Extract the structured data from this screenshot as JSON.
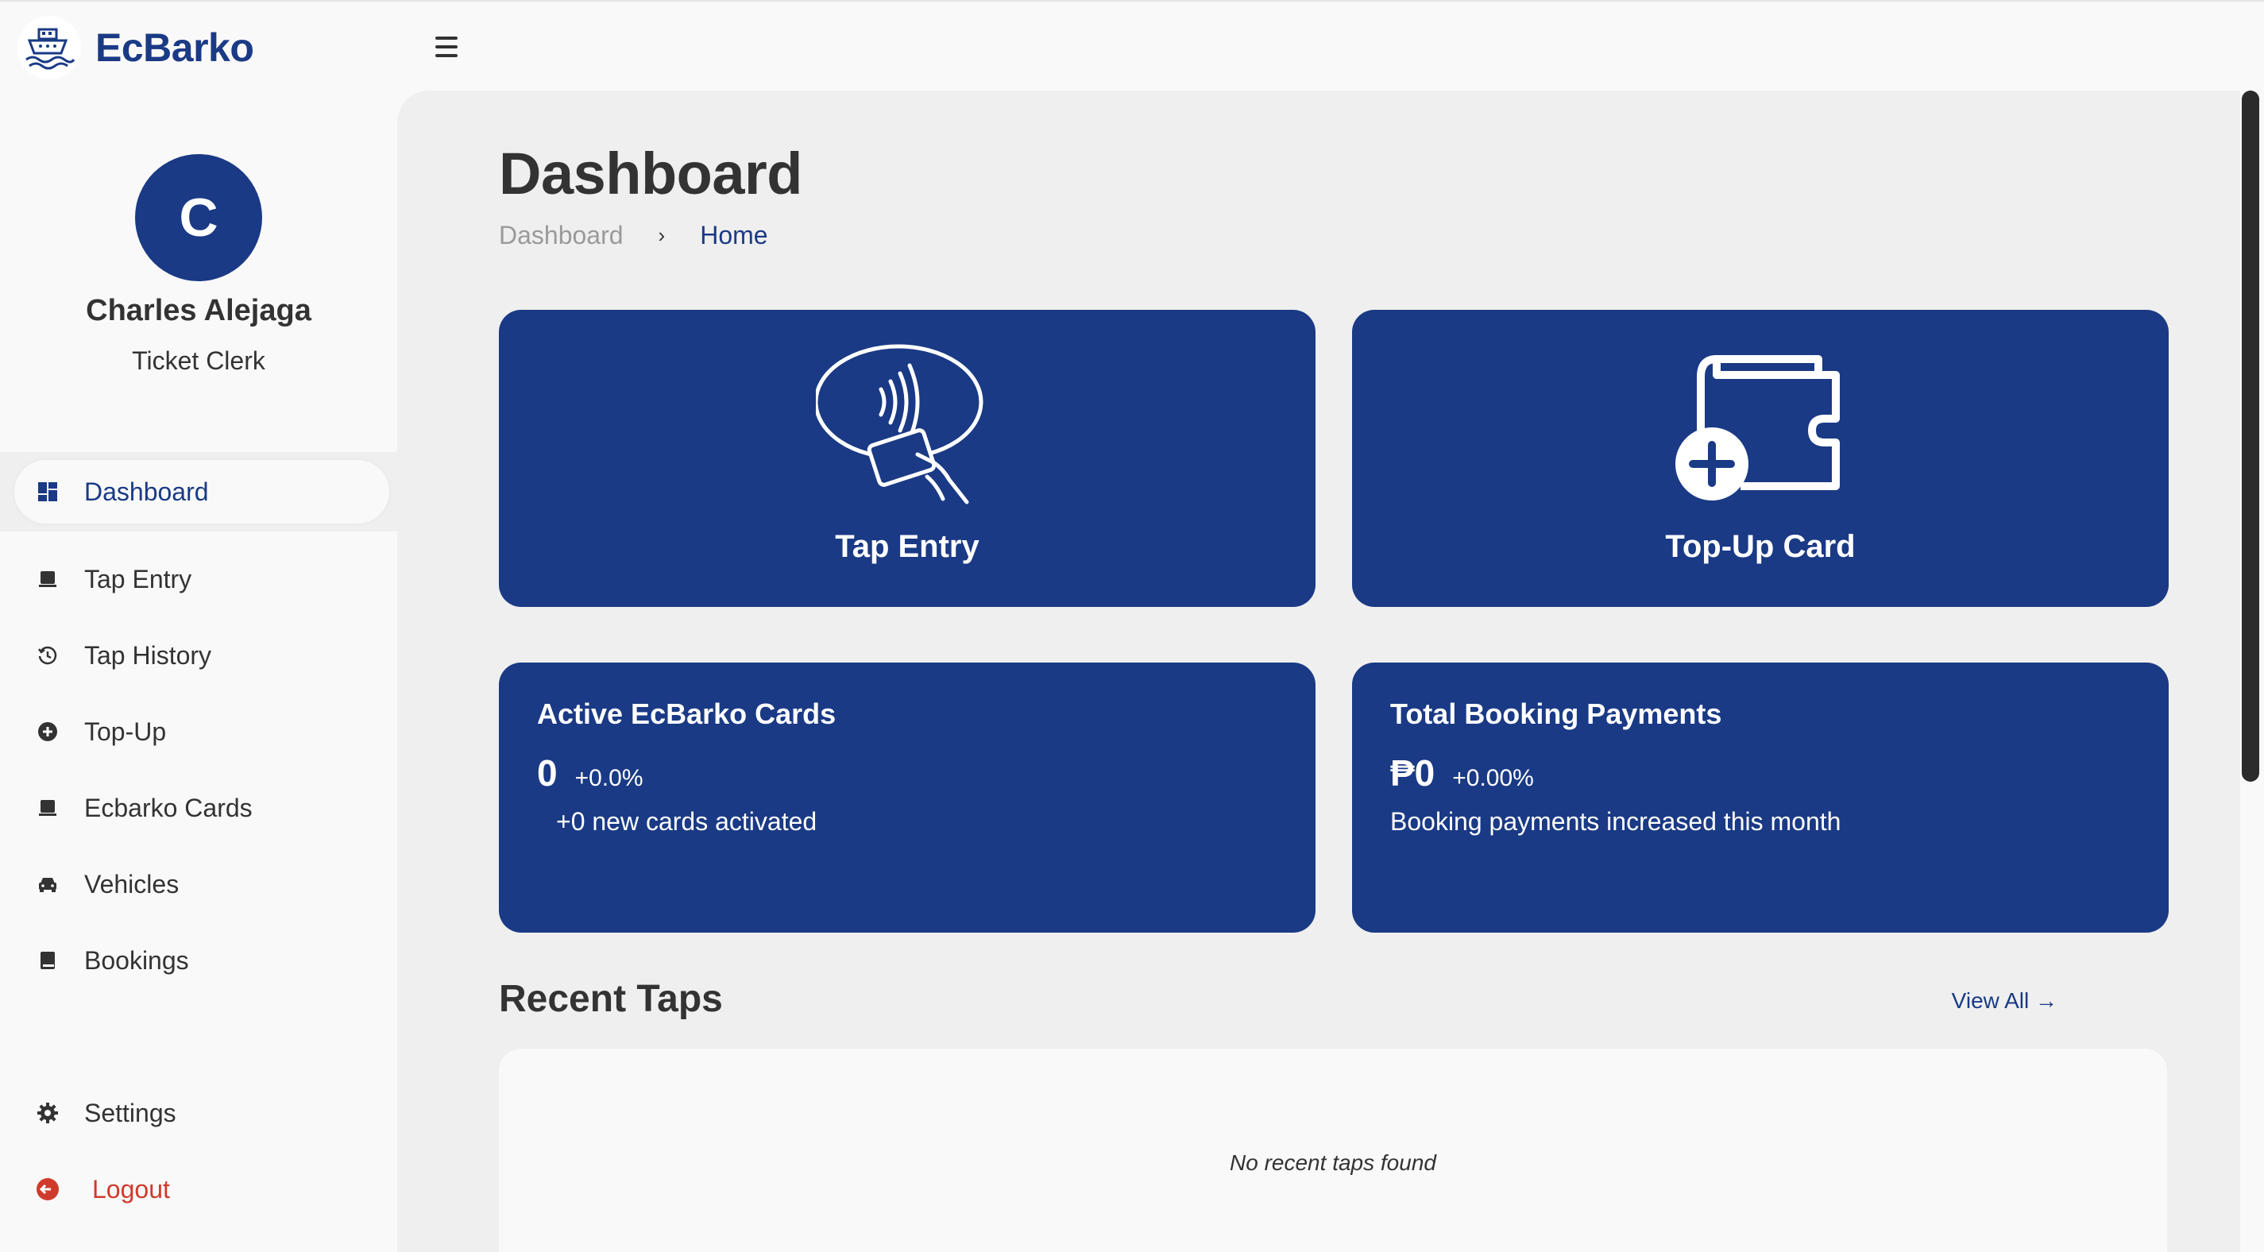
{
  "app": {
    "name": "EcBarko"
  },
  "user": {
    "initial": "C",
    "name": "Charles Alejaga",
    "role": "Ticket Clerk"
  },
  "sidebar": {
    "items": [
      {
        "label": "Dashboard",
        "icon": "dashboard-grid-icon",
        "active": true
      },
      {
        "label": "Tap Entry",
        "icon": "card-icon"
      },
      {
        "label": "Tap History",
        "icon": "history-icon"
      },
      {
        "label": "Top-Up",
        "icon": "plus-circle-icon"
      },
      {
        "label": "Ecbarko Cards",
        "icon": "card-icon"
      },
      {
        "label": "Vehicles",
        "icon": "car-icon"
      },
      {
        "label": "Bookings",
        "icon": "book-icon"
      }
    ],
    "settings": {
      "label": "Settings",
      "icon": "gear-icon"
    },
    "logout": {
      "label": "Logout",
      "icon": "logout-icon"
    }
  },
  "page": {
    "title": "Dashboard",
    "breadcrumb": [
      "Dashboard",
      "Home"
    ]
  },
  "actions": {
    "tap_entry": {
      "label": "Tap Entry",
      "icon": "tap-card-icon"
    },
    "top_up": {
      "label": "Top-Up Card",
      "icon": "wallet-plus-icon"
    }
  },
  "stats": {
    "cards": {
      "title": "Active EcBarko Cards",
      "value": "0",
      "change": "+0.0%",
      "note": "+0 new cards activated"
    },
    "payments": {
      "title": "Total Booking Payments",
      "value": "₱0",
      "change": "+0.00%",
      "note": "Booking payments increased this month"
    }
  },
  "recent_taps": {
    "title": "Recent Taps",
    "view_all": "View All →",
    "empty": "No recent taps found"
  },
  "colors": {
    "brand": "#1a3a85",
    "logout": "#d03a2c",
    "background": "#efefef"
  }
}
